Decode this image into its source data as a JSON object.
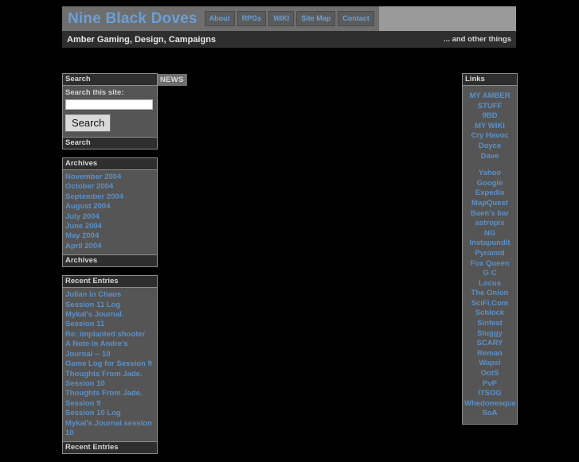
{
  "banner": {
    "site_title": "Nine Black Doves",
    "nav": [
      {
        "label": "About"
      },
      {
        "label": "RPGs"
      },
      {
        "label": "WIKI"
      },
      {
        "label": "Site Map"
      },
      {
        "label": "Contact"
      }
    ],
    "tagline": "Amber Gaming, Design, Campaigns",
    "tagline_right": "... and other things"
  },
  "news_tab": {
    "label": "NEWS"
  },
  "search_panel": {
    "header": "Search",
    "footer": "Search",
    "label": "Search this site:",
    "input_value": "",
    "input_placeholder": "",
    "button_label": "Search"
  },
  "archives_panel": {
    "header": "Archives",
    "footer": "Archives",
    "items": [
      {
        "label": "November 2004"
      },
      {
        "label": "October 2004"
      },
      {
        "label": "September 2004"
      },
      {
        "label": "August 2004"
      },
      {
        "label": "July 2004"
      },
      {
        "label": "June 2004"
      },
      {
        "label": "May 2004"
      },
      {
        "label": "April 2004"
      }
    ]
  },
  "recent_entries_panel": {
    "header": "Recent Entries",
    "footer": "Recent Entries",
    "items": [
      {
        "label": "Julian in Chaos"
      },
      {
        "label": "Session 11 Log"
      },
      {
        "label": "Mykal's Journal. Session 11"
      },
      {
        "label": "Re: implanted shooter"
      },
      {
        "label": "A Note in Andre's Journal -- 10"
      },
      {
        "label": "Game Log for Session 9"
      },
      {
        "label": "Thoughts From Jade. Session 10"
      },
      {
        "label": "Thoughts From Jade. Session 9"
      },
      {
        "label": "Session 10 Log"
      },
      {
        "label": "Mykal's Journal session 10"
      }
    ]
  },
  "links_panel": {
    "header": "Links",
    "items": [
      {
        "label": "MY AMBER STUFF"
      },
      {
        "label": "9BD"
      },
      {
        "label": "MY WIKI"
      },
      {
        "label": "Cry Havoc"
      },
      {
        "label": "Doyce"
      },
      {
        "label": "Dave"
      },
      {
        "label": "",
        "spacer": true
      },
      {
        "label": "Yahoo"
      },
      {
        "label": "Google"
      },
      {
        "label": "Expedia"
      },
      {
        "label": "MapQuest"
      },
      {
        "label": "Baen's bar"
      },
      {
        "label": "astropix"
      },
      {
        "label": "NG"
      },
      {
        "label": "Instapundit"
      },
      {
        "label": "Pyramid"
      },
      {
        "label": "Fox Queen"
      },
      {
        "label": "G C"
      },
      {
        "label": "Locus"
      },
      {
        "label": "The Onion"
      },
      {
        "label": "SciFi.Com"
      },
      {
        "label": "Schlock"
      },
      {
        "label": "Sinfest"
      },
      {
        "label": "Sluggy"
      },
      {
        "label": "SCARY"
      },
      {
        "label": "Reman"
      },
      {
        "label": "Wapsi"
      },
      {
        "label": "OotS"
      },
      {
        "label": "PvP"
      },
      {
        "label": "ITSOG"
      },
      {
        "label": "Whedonesque"
      },
      {
        "label": "SoA"
      }
    ]
  },
  "colors": {
    "page_background": "#000000",
    "banner_light": "#9a9a9a",
    "banner_title_box": "#6e6e6e",
    "banner_bottom": "#2e2e2e",
    "panel_background": "#555555",
    "panel_header": "#2e2e2e",
    "panel_border": "#8d8d8d",
    "link_blue": "#5b90c8",
    "title_blue": "#6b9fd4"
  }
}
